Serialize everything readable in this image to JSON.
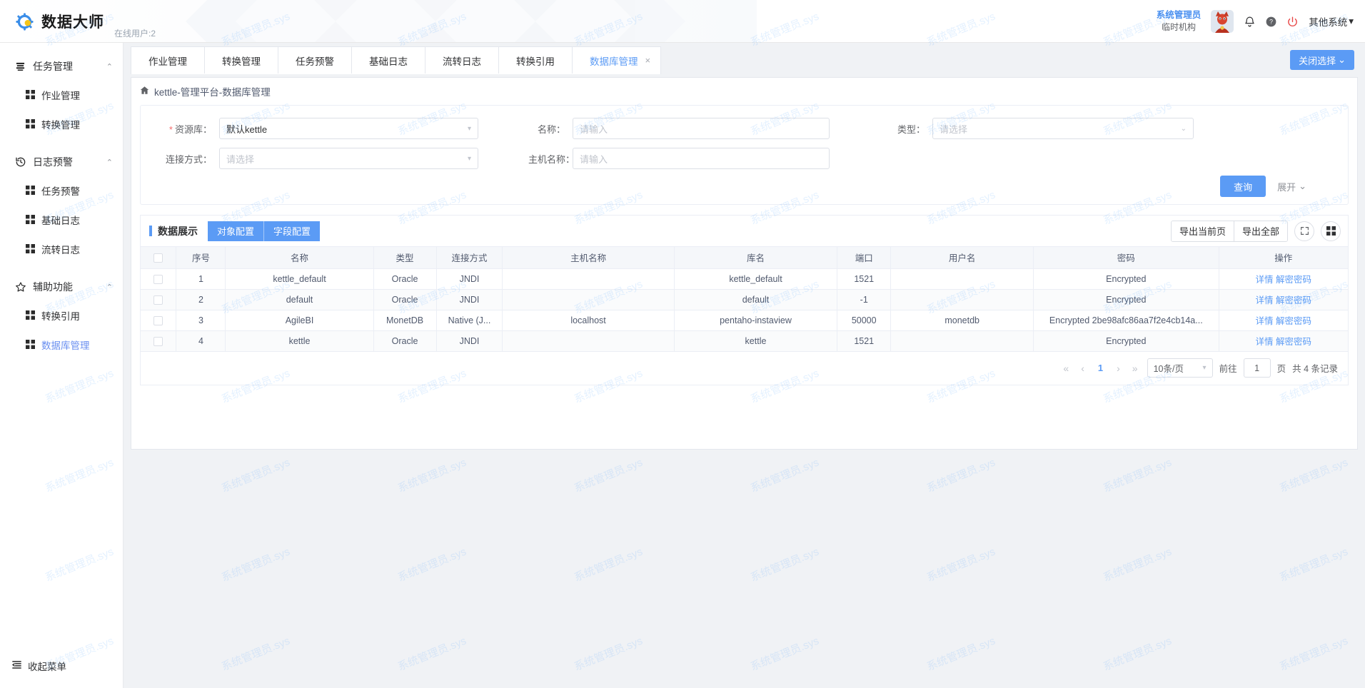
{
  "header": {
    "brand_title": "数据大师",
    "brand_sub": "在线用户:2",
    "user_name": "系统管理员",
    "user_org": "临时机构",
    "bell_icon": "bell-icon",
    "help_icon": "help-icon",
    "power_icon": "power-icon",
    "system_switch": "其他系统",
    "system_switch_caret": "▾"
  },
  "sidebar": {
    "groups": [
      {
        "label": "任务管理",
        "icon": "stack-icon",
        "arrow": "⌃",
        "items": [
          {
            "label": "作业管理",
            "icon": "grid-icon"
          },
          {
            "label": "转换管理",
            "icon": "grid-icon"
          }
        ]
      },
      {
        "label": "日志预警",
        "icon": "history-icon",
        "arrow": "⌃",
        "items": [
          {
            "label": "任务预警",
            "icon": "grid-icon"
          },
          {
            "label": "基础日志",
            "icon": "grid-icon"
          },
          {
            "label": "流转日志",
            "icon": "grid-icon"
          }
        ]
      },
      {
        "label": "辅助功能",
        "icon": "star-icon",
        "arrow": "⌃",
        "items": [
          {
            "label": "转换引用",
            "icon": "grid-icon"
          },
          {
            "label": "数据库管理",
            "icon": "grid-icon"
          }
        ]
      }
    ],
    "collapse_label": "收起菜单",
    "collapse_icon": "collapse-menu-icon",
    "active_item": "数据库管理"
  },
  "tabbar": {
    "tabs": [
      {
        "label": "作业管理",
        "active": false,
        "closable": false
      },
      {
        "label": "转换管理",
        "active": false,
        "closable": false
      },
      {
        "label": "任务预警",
        "active": false,
        "closable": false
      },
      {
        "label": "基础日志",
        "active": false,
        "closable": false
      },
      {
        "label": "流转日志",
        "active": false,
        "closable": false
      },
      {
        "label": "转换引用",
        "active": false,
        "closable": false
      },
      {
        "label": "数据库管理",
        "active": true,
        "closable": true
      }
    ],
    "close_icon": "×",
    "close_select_label": "关闭选择",
    "close_select_caret": "⌄"
  },
  "breadcrumb": {
    "home_icon": "home-icon",
    "text": "kettle-管理平台-数据库管理"
  },
  "search_form": {
    "repository": {
      "label": "资源库：",
      "required": true,
      "value": "默认kettle",
      "caret": "▾"
    },
    "name": {
      "label": "名称：",
      "placeholder": "请输入",
      "value": ""
    },
    "type": {
      "label": "类型：",
      "placeholder": "请选择",
      "value": "",
      "caret": "⌄"
    },
    "connect_mode": {
      "label": "连接方式：",
      "placeholder": "请选择",
      "value": "",
      "caret": "▾"
    },
    "host_name": {
      "label": "主机名称：",
      "placeholder": "请输入",
      "value": ""
    },
    "query_button": "查询",
    "expand_label": "展开",
    "expand_caret": "⌄"
  },
  "table_panel": {
    "title": "数据展示",
    "segments": [
      "对象配置",
      "字段配置"
    ],
    "export_current": "导出当前页",
    "export_all": "导出全部",
    "fullscreen_icon": "fullscreen-icon",
    "columns_icon": "column-settings-icon",
    "columns": [
      "",
      "序号",
      "名称",
      "类型",
      "连接方式",
      "主机名称",
      "库名",
      "端口",
      "用户名",
      "密码",
      "操作"
    ],
    "rows": [
      {
        "seq": "1",
        "name": "kettle_default",
        "type": "Oracle",
        "conn": "JNDI",
        "host": "",
        "db": "kettle_default",
        "port": "1521",
        "user": "",
        "password": "Encrypted",
        "actions": [
          "详情",
          "解密密码"
        ]
      },
      {
        "seq": "2",
        "name": "default",
        "type": "Oracle",
        "conn": "JNDI",
        "host": "",
        "db": "default",
        "port": "-1",
        "user": "",
        "password": "Encrypted",
        "actions": [
          "详情",
          "解密密码"
        ]
      },
      {
        "seq": "3",
        "name": "AgileBI",
        "type": "MonetDB",
        "conn": "Native (J...",
        "host": "localhost",
        "db": "pentaho-instaview",
        "port": "50000",
        "user": "monetdb",
        "password": "Encrypted 2be98afc86aa7f2e4cb14a...",
        "actions": [
          "详情",
          "解密密码"
        ]
      },
      {
        "seq": "4",
        "name": "kettle",
        "type": "Oracle",
        "conn": "JNDI",
        "host": "",
        "db": "kettle",
        "port": "1521",
        "user": "",
        "password": "Encrypted",
        "actions": [
          "详情",
          "解密密码"
        ]
      }
    ]
  },
  "pagination": {
    "first_icon": "«",
    "prev_icon": "‹",
    "pages": [
      "1"
    ],
    "current_page": "1",
    "next_icon": "›",
    "last_icon": "»",
    "page_size": "10条/页",
    "page_size_caret": "▾",
    "goto_label": "前往",
    "goto_value": "1",
    "page_unit": "页",
    "total_text": "共 4 条记录"
  },
  "watermark": {
    "text": "系统管理员.sys"
  },
  "colors": {
    "accent": "#5b9bf5",
    "link": "#5b9bf5",
    "required": "#f56c6c",
    "power": "#e84545"
  }
}
